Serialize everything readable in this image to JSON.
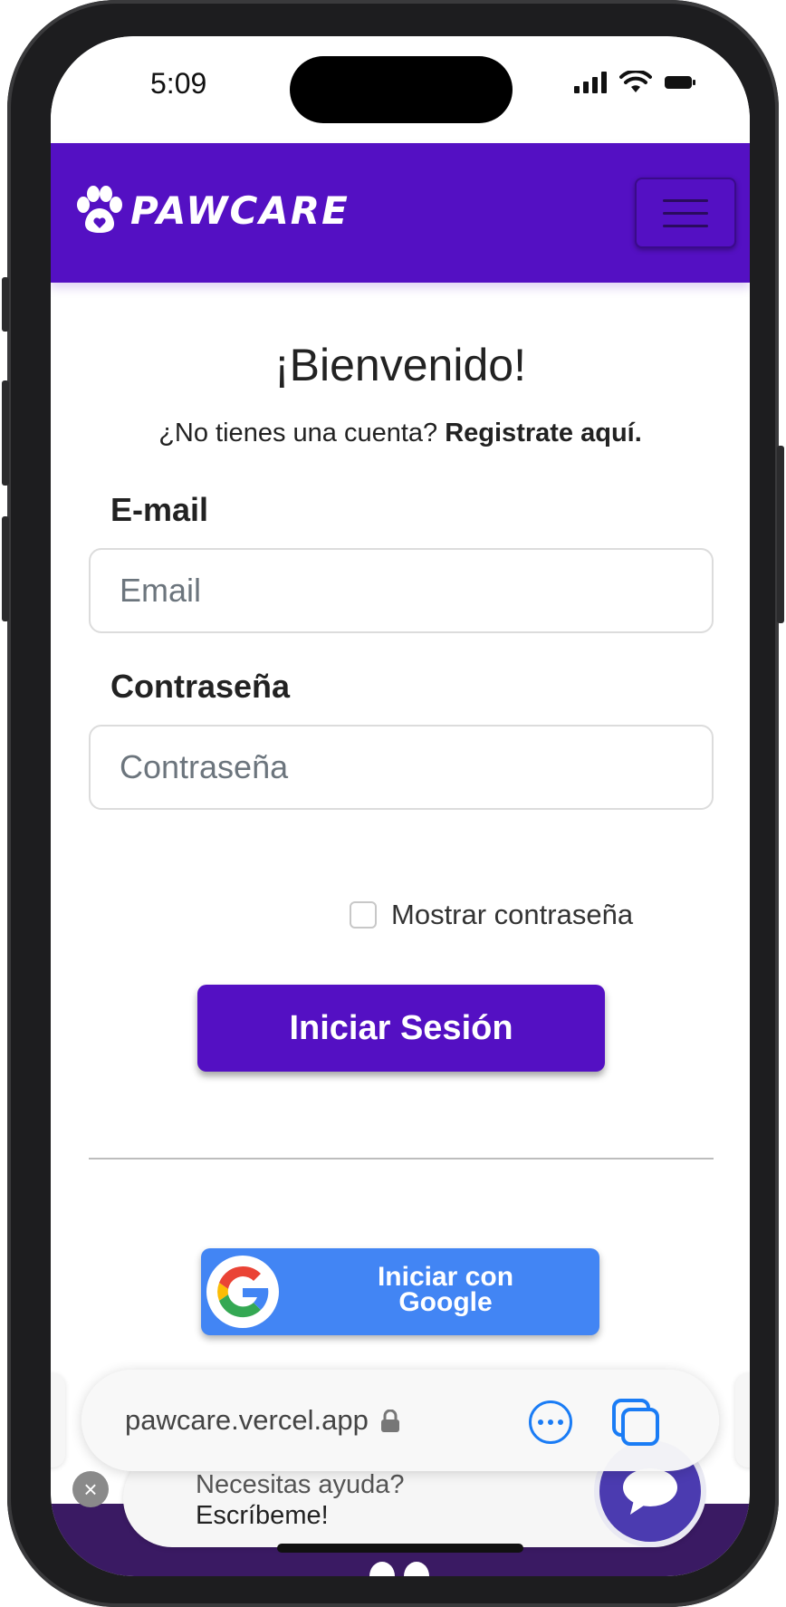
{
  "status_bar": {
    "time": "5:09"
  },
  "navbar": {
    "brand": "PAWCARE"
  },
  "login": {
    "title": "¡Bienvenido!",
    "subtitle_prefix": "¿No tienes una cuenta?",
    "subtitle_link": "Registrate aquí.",
    "email_label": "E-mail",
    "email_placeholder": "Email",
    "password_label": "Contraseña",
    "password_placeholder": "Contraseña",
    "show_password_label": "Mostrar contraseña",
    "submit_label": "Iniciar Sesión",
    "google_label_line1": "Iniciar con",
    "google_label_line2": "Google"
  },
  "browser": {
    "url": "pawcare.vercel.app"
  },
  "chat": {
    "line1": "Necesitas ayuda?",
    "line2": "Escríbeme!"
  },
  "colors": {
    "brand_purple": "#5410c3",
    "google_blue": "#4285f4",
    "safari_blue": "#1a7cf5"
  }
}
